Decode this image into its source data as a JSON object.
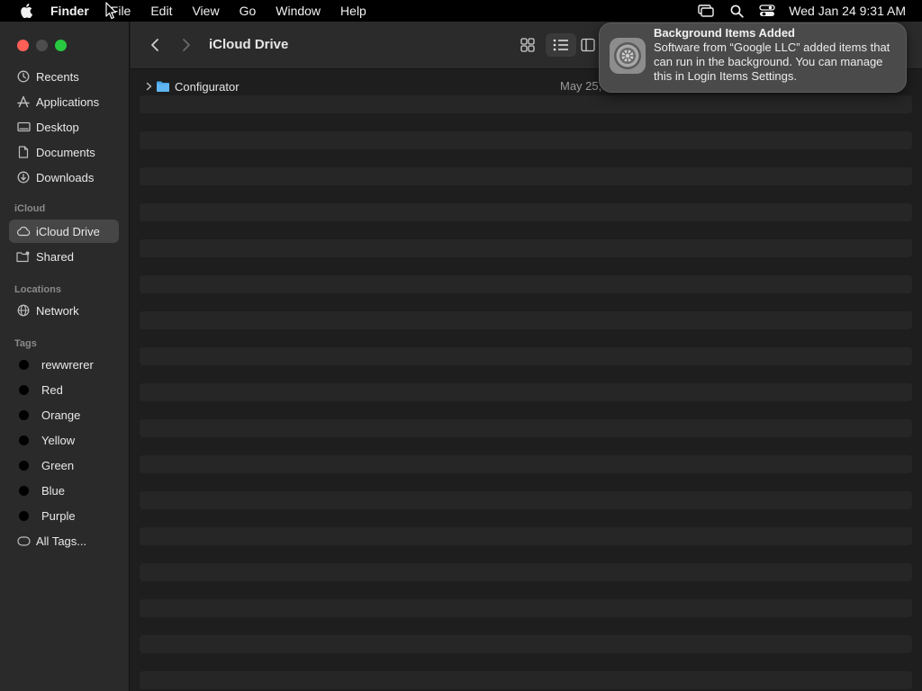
{
  "menubar": {
    "app_name": "Finder",
    "items": [
      "File",
      "Edit",
      "View",
      "Go",
      "Window",
      "Help"
    ],
    "clock": "Wed Jan 24  9:31 AM"
  },
  "window": {
    "title": "iCloud Drive"
  },
  "sidebar": {
    "favorites": [
      {
        "label": "Recents",
        "icon": "clock-icon"
      },
      {
        "label": "Applications",
        "icon": "applications-icon"
      },
      {
        "label": "Desktop",
        "icon": "desktop-icon"
      },
      {
        "label": "Documents",
        "icon": "document-icon"
      },
      {
        "label": "Downloads",
        "icon": "download-icon"
      }
    ],
    "icloud_header": "iCloud",
    "icloud": [
      {
        "label": "iCloud Drive",
        "icon": "cloud-icon",
        "active": true
      },
      {
        "label": "Shared",
        "icon": "shared-folder-icon"
      }
    ],
    "locations_header": "Locations",
    "locations": [
      {
        "label": "Network",
        "icon": "globe-icon"
      }
    ],
    "tags_header": "Tags",
    "tags": [
      "rewwrerer",
      "Red",
      "Orange",
      "Yellow",
      "Green",
      "Blue",
      "Purple"
    ],
    "all_tags": "All Tags..."
  },
  "files": [
    {
      "name": "Configurator",
      "date": "May 25,",
      "type": "folder"
    }
  ],
  "notification": {
    "title": "Background Items Added",
    "body": "Software from “Google LLC” added items that can run in the background. You can manage this in Login Items Settings."
  },
  "colors": {
    "close": "#ff5f57",
    "minimize": "#4d4d4d",
    "zoom": "#28c840",
    "folder": "#4aa8ec",
    "tag_dot": "#000000"
  }
}
